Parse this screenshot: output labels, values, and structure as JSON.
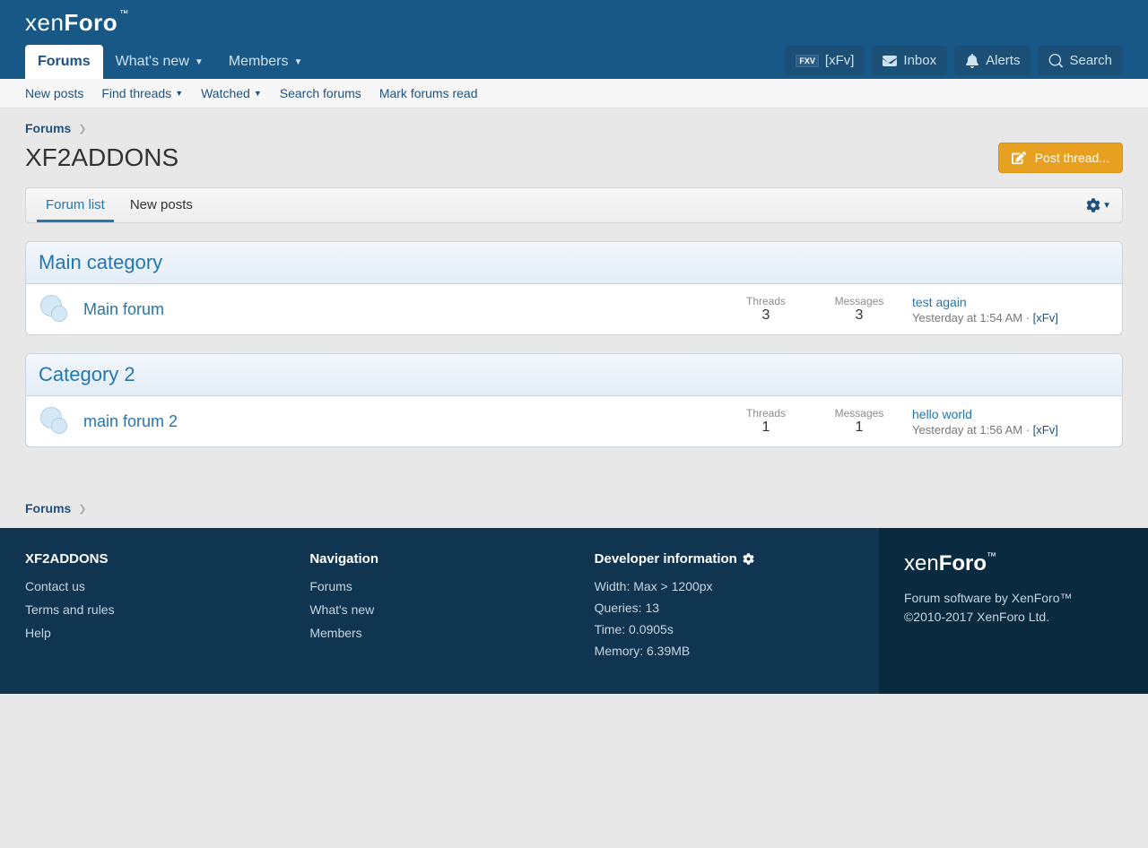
{
  "brand": "xenForo",
  "nav": {
    "tabs": [
      {
        "label": "Forums",
        "active": true,
        "hasCaret": false
      },
      {
        "label": "What's new",
        "active": false,
        "hasCaret": true
      },
      {
        "label": "Members",
        "active": false,
        "hasCaret": true
      }
    ],
    "user": {
      "badge": "FXV",
      "name": "[xFv]"
    },
    "inbox": "Inbox",
    "alerts": "Alerts",
    "search": "Search"
  },
  "subnav": [
    {
      "label": "New posts",
      "caret": false
    },
    {
      "label": "Find threads",
      "caret": true
    },
    {
      "label": "Watched",
      "caret": true
    },
    {
      "label": "Search forums",
      "caret": false
    },
    {
      "label": "Mark forums read",
      "caret": false
    }
  ],
  "breadcrumb": {
    "root": "Forums"
  },
  "page_title": "XF2ADDONS",
  "post_button": "Post thread...",
  "content_tabs": [
    {
      "label": "Forum list",
      "active": true
    },
    {
      "label": "New posts",
      "active": false
    }
  ],
  "stat_labels": {
    "threads": "Threads",
    "messages": "Messages"
  },
  "categories": [
    {
      "name": "Main category",
      "forums": [
        {
          "title": "Main forum",
          "threads": "3",
          "messages": "3",
          "latest_title": "test again",
          "latest_time": "Yesterday at 1:54 AM",
          "latest_user": "[xFv]"
        }
      ]
    },
    {
      "name": "Category 2",
      "forums": [
        {
          "title": "main forum 2",
          "threads": "1",
          "messages": "1",
          "latest_title": "hello world",
          "latest_time": "Yesterday at 1:56 AM",
          "latest_user": "[xFv]"
        }
      ]
    }
  ],
  "footer": {
    "col1": {
      "title": "XF2ADDONS",
      "links": [
        "Contact us",
        "Terms and rules",
        "Help"
      ]
    },
    "col2": {
      "title": "Navigation",
      "links": [
        "Forums",
        "What's new",
        "Members"
      ]
    },
    "col3": {
      "title": "Developer information",
      "lines": [
        "Width: Max > 1200px",
        "Queries: 13",
        "Time: 0.0905s",
        "Memory: 6.39MB"
      ]
    },
    "right": {
      "line1": "Forum software by XenForo™",
      "line2": "©2010-2017 XenForo Ltd."
    }
  }
}
